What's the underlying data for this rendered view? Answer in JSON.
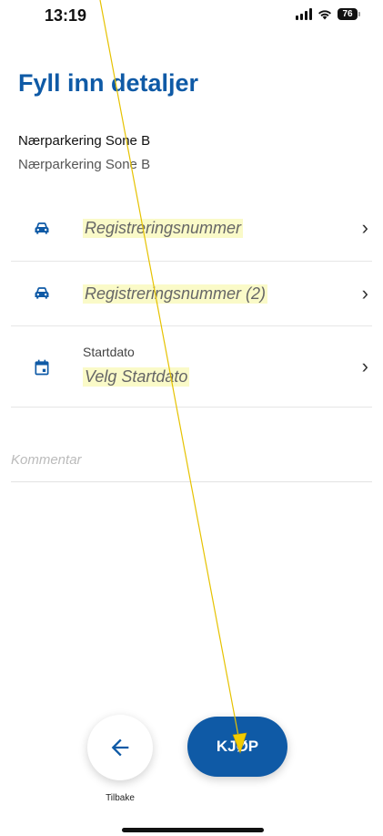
{
  "status_bar": {
    "time": "13:19",
    "battery": "76",
    "icons": [
      "signal-icon",
      "wifi-icon",
      "battery-icon"
    ]
  },
  "page": {
    "title": "Fyll inn detaljer"
  },
  "zone": {
    "name": "Nærparkering Sone B",
    "subtitle": "Nærparkering Sone B"
  },
  "fields": {
    "registration_1": {
      "value": "Registreringsnummer",
      "icon": "car-icon"
    },
    "registration_2": {
      "value": "Registreringsnummer (2)",
      "icon": "car-icon"
    },
    "start_date": {
      "label": "Startdato",
      "value": "Velg Startdato",
      "icon": "calendar-icon"
    }
  },
  "comment": {
    "placeholder": "Kommentar",
    "value": ""
  },
  "actions": {
    "back_label": "Tilbake",
    "buy_label": "KJØP"
  },
  "colors": {
    "primary": "#0f5aa6",
    "highlight": "#fafac8",
    "annotation": "#e6c200"
  }
}
